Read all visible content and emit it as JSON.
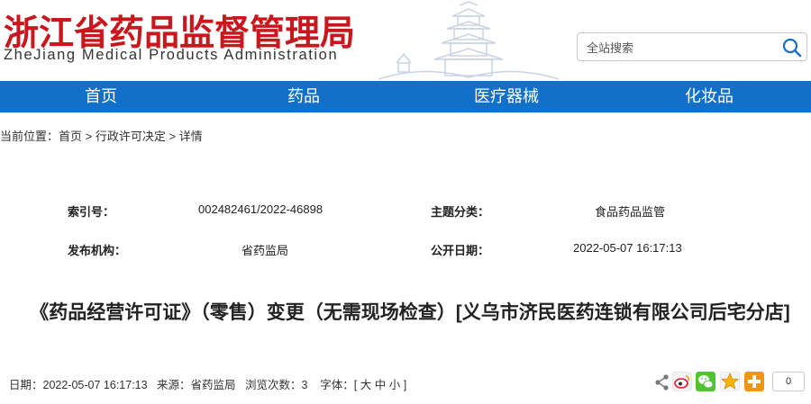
{
  "header": {
    "title_cn": "浙江省药品监督管理局",
    "title_en": "ZheJiang Medical Products Administration"
  },
  "search": {
    "placeholder": "全站搜索",
    "icon": "search-icon"
  },
  "nav": {
    "items": [
      "首页",
      "药品",
      "医疗器械",
      "化妆品"
    ]
  },
  "breadcrumb": {
    "prefix": "当前位置：",
    "items": [
      "首页",
      "行政许可决定",
      "详情"
    ],
    "separator": " > "
  },
  "meta": {
    "index_label": "索引号：",
    "index_value": "002482461/2022-46898",
    "topic_label": "主题分类：",
    "topic_value": "食品药品监管",
    "org_label": "发布机构：",
    "org_value": "省药监局",
    "date_label": "公开日期：",
    "date_value": "2022-05-07 16:17:13"
  },
  "article": {
    "title": "《药品经营许可证》（零售）变更（无需现场检查）[义乌市济民医药连锁有限公司后宅分店]"
  },
  "info": {
    "date": "日期：2022-05-07 16:17:13",
    "source": "来源：省药监局",
    "views": "浏览次数：3",
    "font_prefix": "字体：[",
    "font_large": "大",
    "font_medium": "中",
    "font_small": "小",
    "font_suffix": "]"
  },
  "share": {
    "count": "0",
    "icons": [
      "share-icon",
      "weibo-icon",
      "wechat-icon",
      "qzone-icon",
      "more-icon"
    ]
  },
  "colors": {
    "brand_red": "#c8171d",
    "nav_blue": "#1270c8"
  }
}
